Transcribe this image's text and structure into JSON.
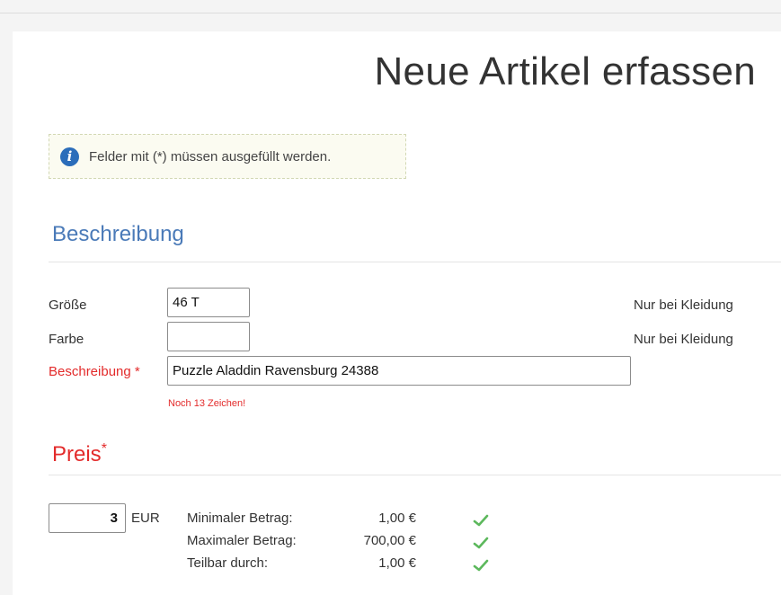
{
  "page_title": "Neue Artikel erfassen",
  "info": {
    "icon": "info-icon",
    "text": "Felder mit (*) müssen ausgefüllt werden."
  },
  "section_description": {
    "title": "Beschreibung",
    "fields": {
      "size": {
        "label": "Größe",
        "value": "46 T",
        "hint": "Nur bei Kleidung"
      },
      "color": {
        "label": "Farbe",
        "value": "",
        "hint": "Nur bei Kleidung"
      },
      "description": {
        "label": "Beschreibung",
        "required_mark": "*",
        "value": "Puzzle Aladdin Ravensburg 24388",
        "warning": "Noch 13 Zeichen!"
      }
    }
  },
  "section_price": {
    "title": "Preis",
    "required_mark": "*",
    "value": "3",
    "currency": "EUR",
    "rules": [
      {
        "label": "Minimaler Betrag:",
        "value": "1,00 €",
        "ok": true
      },
      {
        "label": "Maximaler Betrag:",
        "value": "700,00 €",
        "ok": true
      },
      {
        "label": "Teilbar durch:",
        "value": "1,00 €",
        "ok": true
      }
    ]
  },
  "colors": {
    "accent_blue": "#4a7ab8",
    "required_red": "#e32b2b",
    "check_green": "#5cb85c",
    "info_icon_blue": "#2b6dba"
  }
}
